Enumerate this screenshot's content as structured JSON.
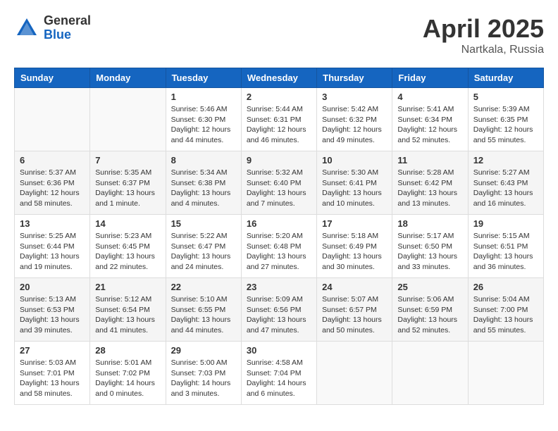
{
  "header": {
    "logo_general": "General",
    "logo_blue": "Blue",
    "title": "April 2025",
    "location": "Nartkala, Russia"
  },
  "weekdays": [
    "Sunday",
    "Monday",
    "Tuesday",
    "Wednesday",
    "Thursday",
    "Friday",
    "Saturday"
  ],
  "weeks": [
    [
      {
        "day": "",
        "info": ""
      },
      {
        "day": "",
        "info": ""
      },
      {
        "day": "1",
        "info": "Sunrise: 5:46 AM\nSunset: 6:30 PM\nDaylight: 12 hours and 44 minutes."
      },
      {
        "day": "2",
        "info": "Sunrise: 5:44 AM\nSunset: 6:31 PM\nDaylight: 12 hours and 46 minutes."
      },
      {
        "day": "3",
        "info": "Sunrise: 5:42 AM\nSunset: 6:32 PM\nDaylight: 12 hours and 49 minutes."
      },
      {
        "day": "4",
        "info": "Sunrise: 5:41 AM\nSunset: 6:34 PM\nDaylight: 12 hours and 52 minutes."
      },
      {
        "day": "5",
        "info": "Sunrise: 5:39 AM\nSunset: 6:35 PM\nDaylight: 12 hours and 55 minutes."
      }
    ],
    [
      {
        "day": "6",
        "info": "Sunrise: 5:37 AM\nSunset: 6:36 PM\nDaylight: 12 hours and 58 minutes."
      },
      {
        "day": "7",
        "info": "Sunrise: 5:35 AM\nSunset: 6:37 PM\nDaylight: 13 hours and 1 minute."
      },
      {
        "day": "8",
        "info": "Sunrise: 5:34 AM\nSunset: 6:38 PM\nDaylight: 13 hours and 4 minutes."
      },
      {
        "day": "9",
        "info": "Sunrise: 5:32 AM\nSunset: 6:40 PM\nDaylight: 13 hours and 7 minutes."
      },
      {
        "day": "10",
        "info": "Sunrise: 5:30 AM\nSunset: 6:41 PM\nDaylight: 13 hours and 10 minutes."
      },
      {
        "day": "11",
        "info": "Sunrise: 5:28 AM\nSunset: 6:42 PM\nDaylight: 13 hours and 13 minutes."
      },
      {
        "day": "12",
        "info": "Sunrise: 5:27 AM\nSunset: 6:43 PM\nDaylight: 13 hours and 16 minutes."
      }
    ],
    [
      {
        "day": "13",
        "info": "Sunrise: 5:25 AM\nSunset: 6:44 PM\nDaylight: 13 hours and 19 minutes."
      },
      {
        "day": "14",
        "info": "Sunrise: 5:23 AM\nSunset: 6:45 PM\nDaylight: 13 hours and 22 minutes."
      },
      {
        "day": "15",
        "info": "Sunrise: 5:22 AM\nSunset: 6:47 PM\nDaylight: 13 hours and 24 minutes."
      },
      {
        "day": "16",
        "info": "Sunrise: 5:20 AM\nSunset: 6:48 PM\nDaylight: 13 hours and 27 minutes."
      },
      {
        "day": "17",
        "info": "Sunrise: 5:18 AM\nSunset: 6:49 PM\nDaylight: 13 hours and 30 minutes."
      },
      {
        "day": "18",
        "info": "Sunrise: 5:17 AM\nSunset: 6:50 PM\nDaylight: 13 hours and 33 minutes."
      },
      {
        "day": "19",
        "info": "Sunrise: 5:15 AM\nSunset: 6:51 PM\nDaylight: 13 hours and 36 minutes."
      }
    ],
    [
      {
        "day": "20",
        "info": "Sunrise: 5:13 AM\nSunset: 6:53 PM\nDaylight: 13 hours and 39 minutes."
      },
      {
        "day": "21",
        "info": "Sunrise: 5:12 AM\nSunset: 6:54 PM\nDaylight: 13 hours and 41 minutes."
      },
      {
        "day": "22",
        "info": "Sunrise: 5:10 AM\nSunset: 6:55 PM\nDaylight: 13 hours and 44 minutes."
      },
      {
        "day": "23",
        "info": "Sunrise: 5:09 AM\nSunset: 6:56 PM\nDaylight: 13 hours and 47 minutes."
      },
      {
        "day": "24",
        "info": "Sunrise: 5:07 AM\nSunset: 6:57 PM\nDaylight: 13 hours and 50 minutes."
      },
      {
        "day": "25",
        "info": "Sunrise: 5:06 AM\nSunset: 6:59 PM\nDaylight: 13 hours and 52 minutes."
      },
      {
        "day": "26",
        "info": "Sunrise: 5:04 AM\nSunset: 7:00 PM\nDaylight: 13 hours and 55 minutes."
      }
    ],
    [
      {
        "day": "27",
        "info": "Sunrise: 5:03 AM\nSunset: 7:01 PM\nDaylight: 13 hours and 58 minutes."
      },
      {
        "day": "28",
        "info": "Sunrise: 5:01 AM\nSunset: 7:02 PM\nDaylight: 14 hours and 0 minutes."
      },
      {
        "day": "29",
        "info": "Sunrise: 5:00 AM\nSunset: 7:03 PM\nDaylight: 14 hours and 3 minutes."
      },
      {
        "day": "30",
        "info": "Sunrise: 4:58 AM\nSunset: 7:04 PM\nDaylight: 14 hours and 6 minutes."
      },
      {
        "day": "",
        "info": ""
      },
      {
        "day": "",
        "info": ""
      },
      {
        "day": "",
        "info": ""
      }
    ]
  ]
}
